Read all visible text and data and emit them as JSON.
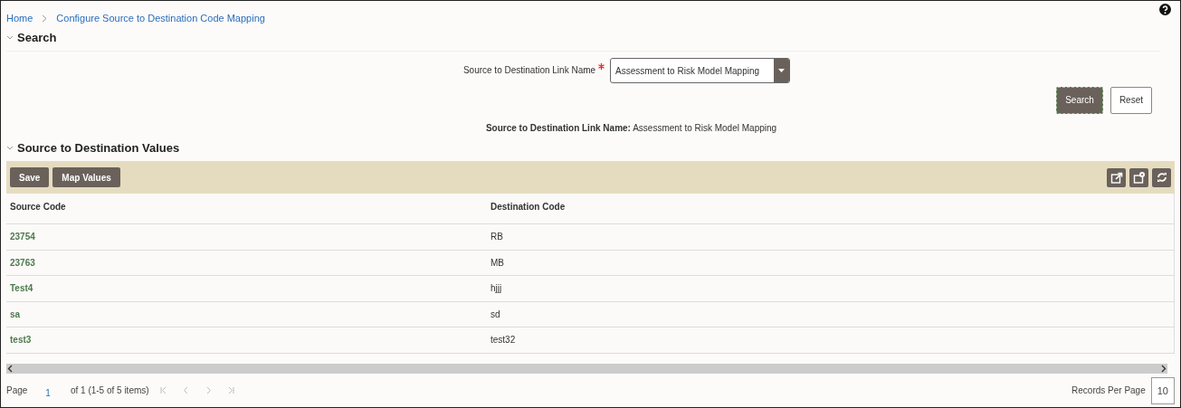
{
  "breadcrumb": [
    "Home",
    "Configure Source to Destination Code Mapping"
  ],
  "search_section": {
    "title": "Search",
    "expanded": true
  },
  "field": {
    "label": "Source to Destination Link Name",
    "required": true,
    "value": "Assessment to Risk Model Mapping"
  },
  "search_buttons": [
    {
      "label": "Search",
      "kind": "primary"
    },
    {
      "label": "Reset",
      "kind": "secondary"
    }
  ],
  "summary": {
    "label": "Source to Destination Link Name:",
    "value": "Assessment to Risk Model Mapping"
  },
  "values_section": {
    "title": "Source to Destination Values",
    "expanded": true
  },
  "toolbar_buttons": [
    "Save",
    "Map Values"
  ],
  "table": {
    "columns": [
      "Source Code",
      "Destination Code"
    ],
    "rows": [
      {
        "source": "23754",
        "destination": "RB"
      },
      {
        "source": "23763",
        "destination": "MB"
      },
      {
        "source": "Test4",
        "destination": "hjjj"
      },
      {
        "source": "sa",
        "destination": "sd"
      },
      {
        "source": "test3",
        "destination": "test32"
      }
    ]
  },
  "pagination": {
    "page_label": "Page",
    "page": "1",
    "of_text": "of 1 (1-5 of 5 items)",
    "records_label": "Records Per Page",
    "records_value": "10"
  }
}
